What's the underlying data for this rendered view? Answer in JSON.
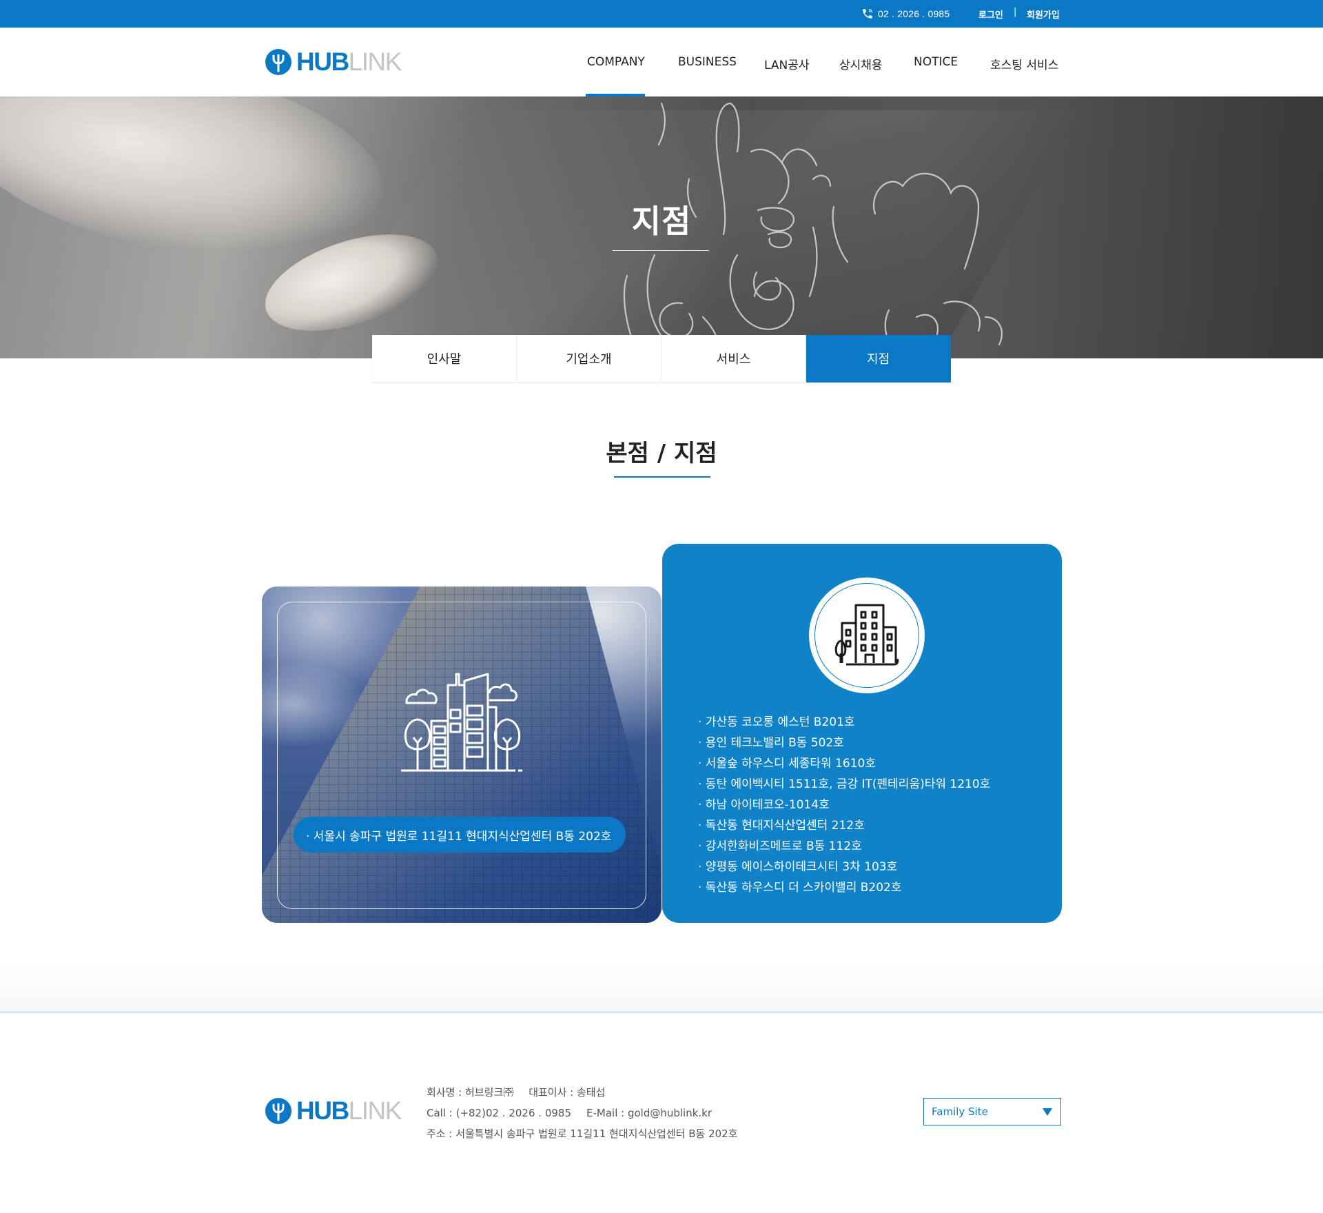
{
  "topbar": {
    "phone_icon": "phone-icon",
    "phone": "02 . 2026 . 0985",
    "login": "로그인",
    "separator": "|",
    "join": "회원가입"
  },
  "brand": {
    "hub": "HUB",
    "link": "LINK",
    "logo_icon": "hublink-logo-icon"
  },
  "nav": {
    "items": [
      "COMPANY",
      "BUSINESS",
      "LAN공사",
      "상시채용",
      "NOTICE",
      "호스팅 서비스"
    ],
    "active": "COMPANY"
  },
  "hero": {
    "title": "지점"
  },
  "subtabs": {
    "items": [
      "인사말",
      "기업소개",
      "서비스",
      "지점"
    ],
    "active": "지점"
  },
  "section": {
    "title": "본점 / 지점"
  },
  "headquarters": {
    "icon": "city-building-icon",
    "address": "· 서울시 송파구 법원로 11길11 현대지식산업센터 B동 202호"
  },
  "branches": {
    "icon": "office-building-icon",
    "items": [
      "· 가산동 코오롱 에스턴 B201호",
      "· 용인 테크노밸리 B동 502호",
      "· 서울숲 하우스디 세종타워 1610호",
      "· 동탄 에이백시티 1511호, 금강 IT(펜테리움)타워 1210호",
      "· 하남 아이테코오-1014호",
      "· 독산동 현대지식산업센터 212호",
      "· 강서한화비즈메트로 B동 112호",
      "· 양평동 에이스하이테크시티 3차 103호",
      "· 독산동 하우스디 더 스카이밸리 B202호"
    ]
  },
  "footer": {
    "company": "회사명 : 허브링크㈜",
    "ceo": "대표이사 : 송태섭",
    "call": "Call :  (+82)02 . 2026 . 0985",
    "email": "E-Mail : gold@hublink.kr",
    "address": "주소 : 서울특별시 송파구 법원로 11길11 현대지식산업센터 B동 202호",
    "family_site": "Family Site"
  },
  "colors": {
    "primary": "#0a78c4",
    "card_blue": "#0f82c8",
    "text": "#222222"
  }
}
